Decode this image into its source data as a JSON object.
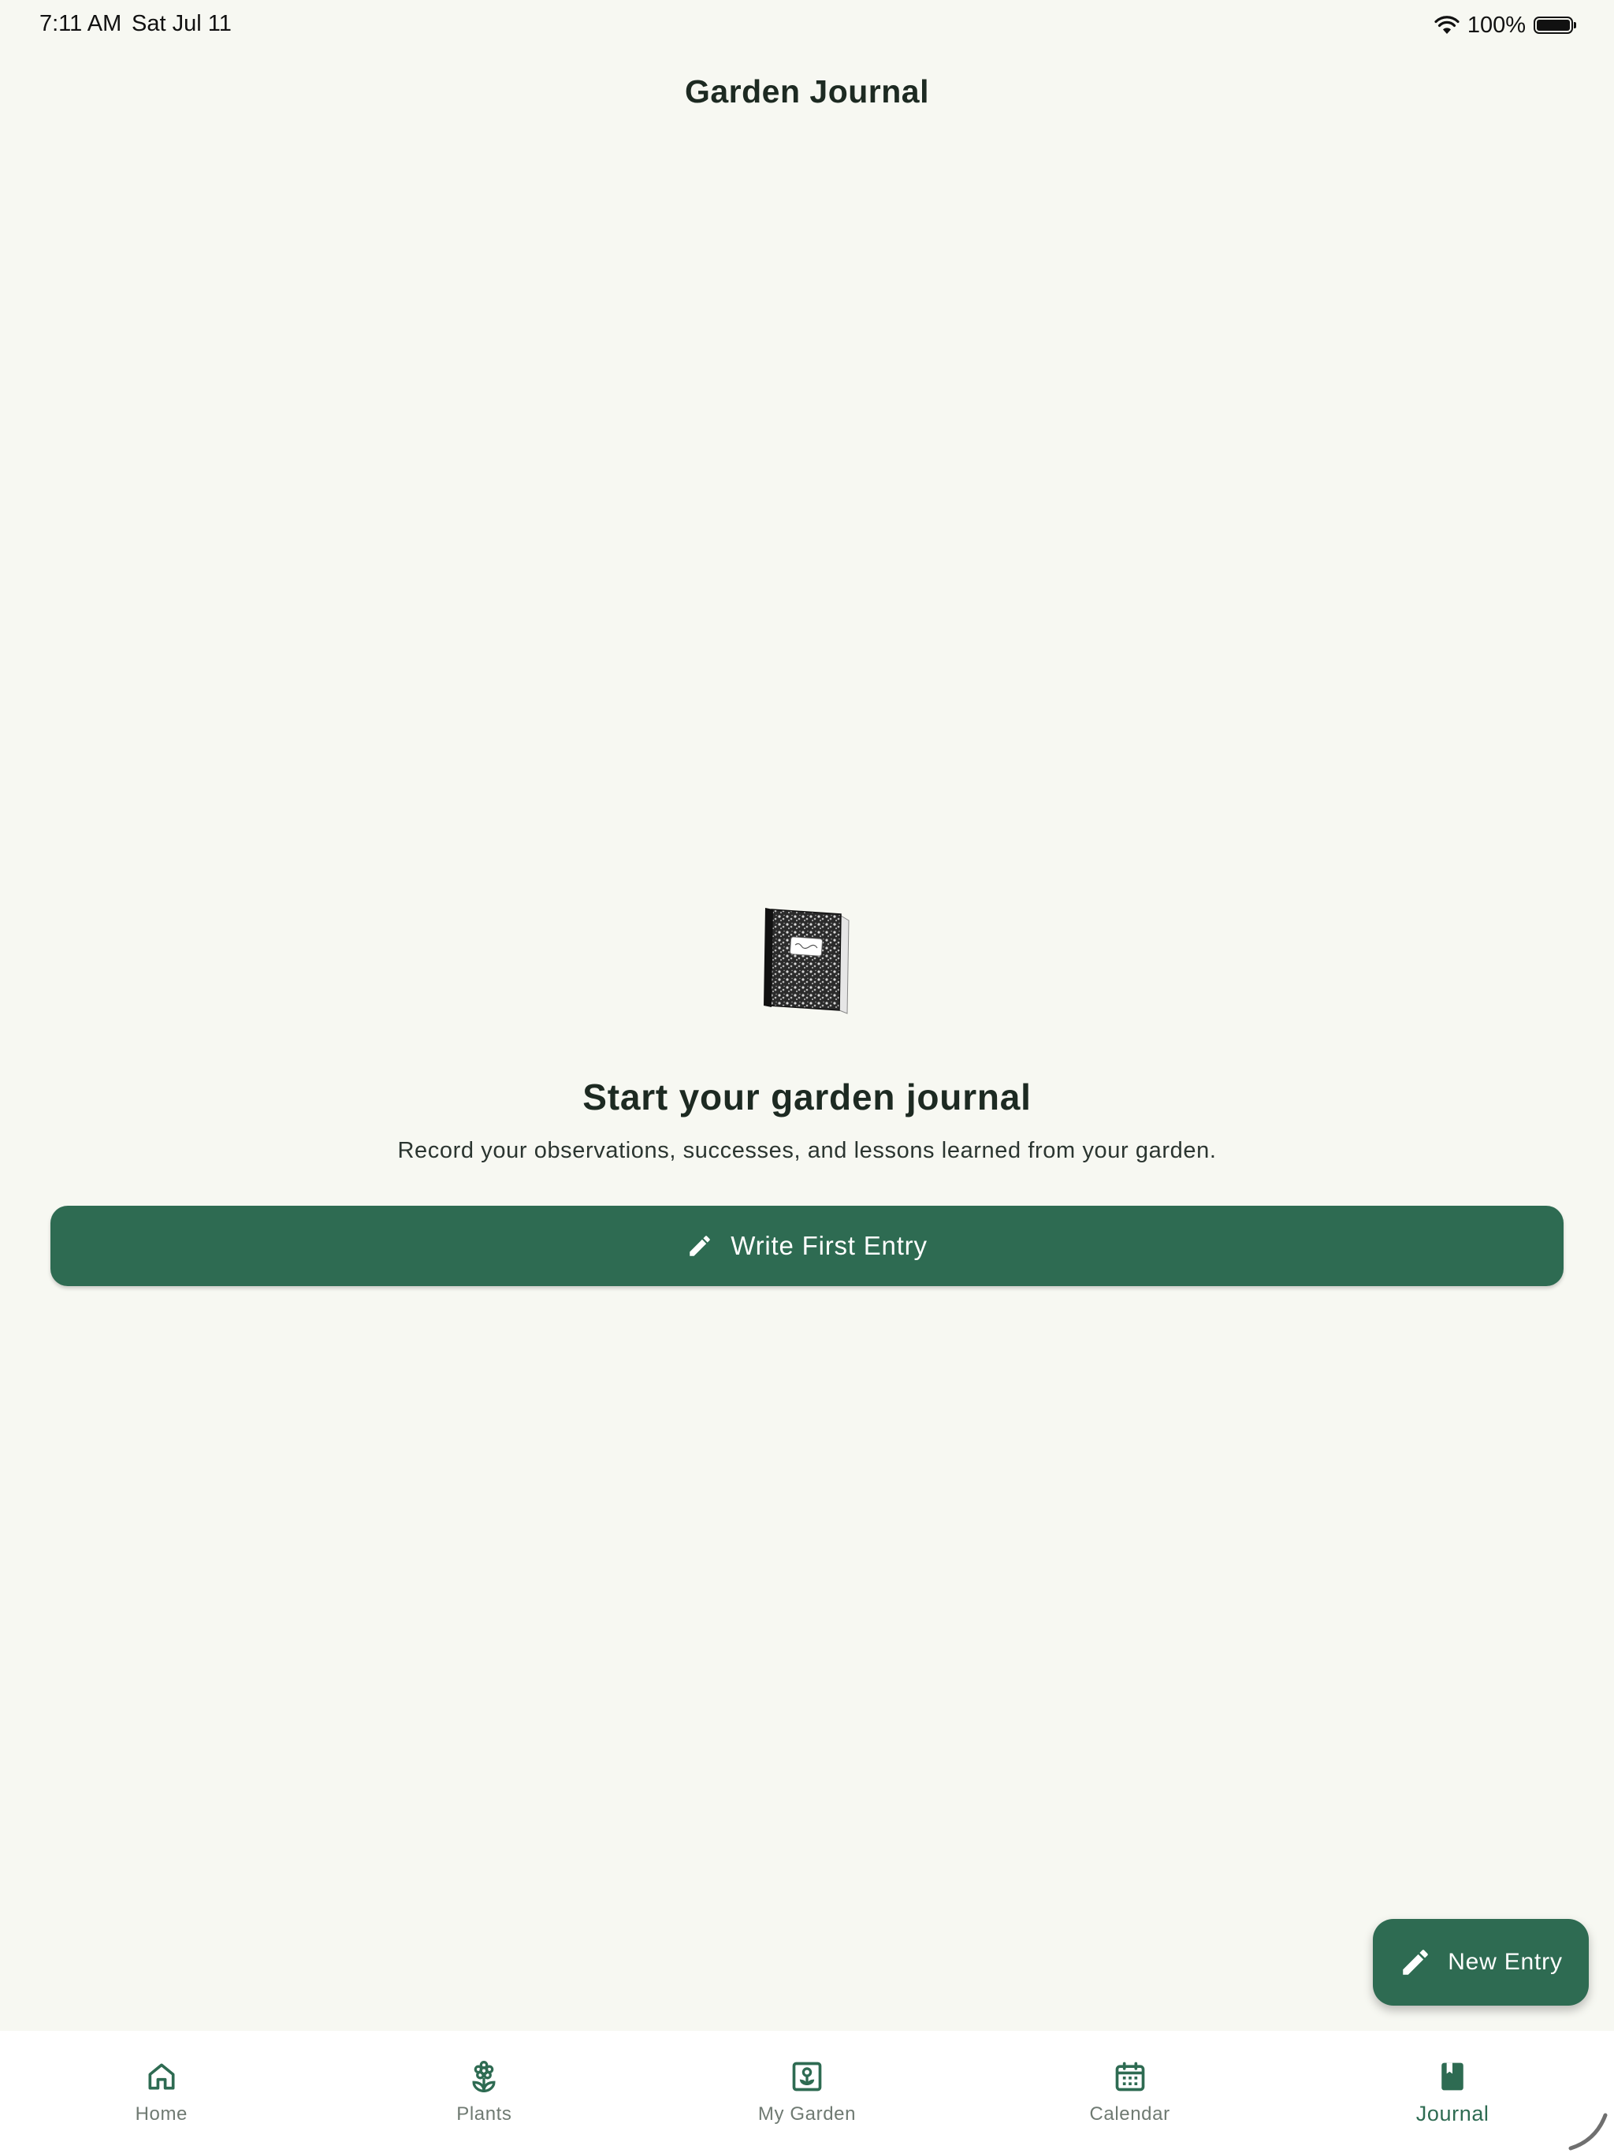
{
  "status_bar": {
    "time": "7:11 AM",
    "date": "Sat Jul 11",
    "battery": "100%",
    "icons": [
      "wifi-icon",
      "battery-icon"
    ]
  },
  "header": {
    "title": "Garden Journal"
  },
  "empty_state": {
    "icon": "notebook-icon",
    "title": "Start your garden journal",
    "description": "Record your observations, successes, and lessons learned from your garden.",
    "button_label": "Write First Entry",
    "button_icon": "pencil-icon"
  },
  "fab": {
    "label": "New Entry",
    "icon": "pencil-icon"
  },
  "bottom_nav": {
    "items": [
      {
        "label": "Home",
        "icon": "home-icon"
      },
      {
        "label": "Plants",
        "icon": "flower-icon"
      },
      {
        "label": "My Garden",
        "icon": "garden-icon"
      },
      {
        "label": "Calendar",
        "icon": "calendar-icon"
      },
      {
        "label": "Journal",
        "icon": "journal-icon"
      }
    ],
    "active": "Journal"
  },
  "colors": {
    "background": "#f7f8f2",
    "primary": "#2e6b52",
    "text": "#1d2a22",
    "nav_inactive": "#6f7a72"
  }
}
